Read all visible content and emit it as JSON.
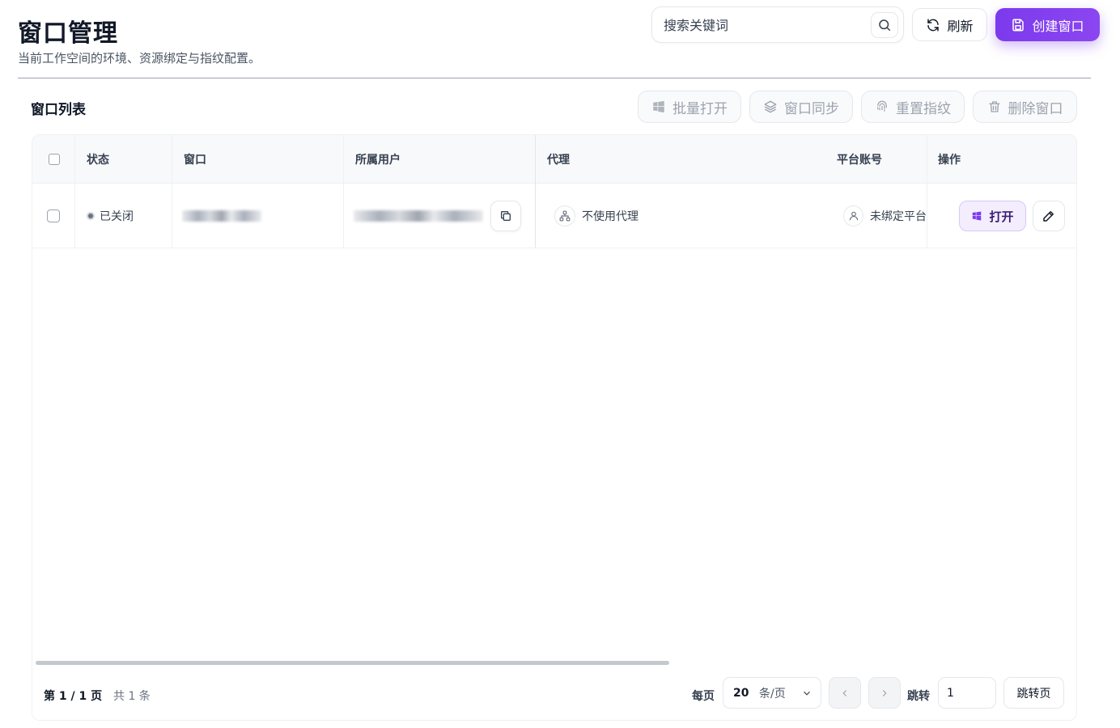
{
  "header": {
    "title": "窗口管理",
    "subtitle": "当前工作空间的环境、资源绑定与指纹配置。",
    "search_placeholder": "搜索关键词",
    "refresh_label": "刷新",
    "create_label": "创建窗口"
  },
  "card": {
    "title": "窗口列表",
    "toolbar": {
      "batch_open": "批量打开",
      "sync_windows": "窗口同步",
      "reset_fingerprint": "重置指纹",
      "delete_windows": "删除窗口"
    }
  },
  "table": {
    "columns": [
      "状态",
      "窗口",
      "所属用户",
      "代理",
      "平台账号",
      "操作"
    ],
    "rows": [
      {
        "status": "已关闭",
        "proxy": "不使用代理",
        "platform_account": "未绑定平台",
        "open_label": "打开"
      }
    ]
  },
  "pagination": {
    "page_info": "第 1 / 1 页",
    "total": "共 1 条",
    "per_page_label": "每页",
    "per_page_value": "20",
    "per_page_unit": "条/页",
    "jump_label": "跳转",
    "jump_value": "1",
    "jump_button": "跳转页"
  },
  "colors": {
    "accent": "#7c3aed",
    "accent_light": "#f3edfe",
    "status_closed": "#6b7280"
  }
}
